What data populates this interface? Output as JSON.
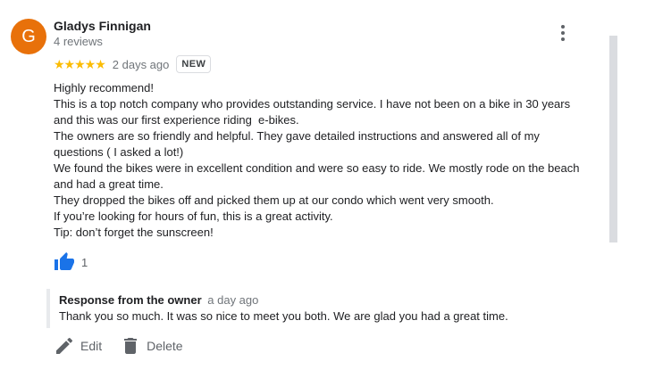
{
  "reviewer": {
    "initial": "G",
    "avatar_color": "#e8710a",
    "name": "Gladys Finnigan",
    "reviews": "4 reviews"
  },
  "menu_icon": "more-vert-icon",
  "rating": {
    "stars": 5,
    "star_display": "★★★★★",
    "star_color": "#fbbc04",
    "date": "2 days ago",
    "badge": "NEW"
  },
  "review": {
    "lines": [
      "Highly recommend!",
      "This is a top notch company who provides outstanding service. I have not been on a bike in 30 years and this was our first experience riding  e-bikes.",
      "The owners are so friendly and helpful. They gave detailed instructions and answered all of my questions ( I asked a lot!)",
      "We found the bikes were in excellent condition and were so easy to ride. We mostly rode on the beach and had a great time.",
      "They dropped the bikes off and picked them up at our condo which went very smooth.",
      "If you’re looking for hours of fun, this is a great activity.",
      "Tip: don’t forget the sunscreen!"
    ]
  },
  "like": {
    "icon": "thumb-up-icon",
    "color": "#1a73e8",
    "count": "1"
  },
  "owner_response": {
    "title": "Response from the owner",
    "date": "a day ago",
    "text": "Thank you so much. It was so nice to meet you both. We are glad you had a great time."
  },
  "actions": {
    "edit_label": "Edit",
    "delete_label": "Delete",
    "edit_icon": "pencil-icon",
    "delete_icon": "trash-icon"
  }
}
